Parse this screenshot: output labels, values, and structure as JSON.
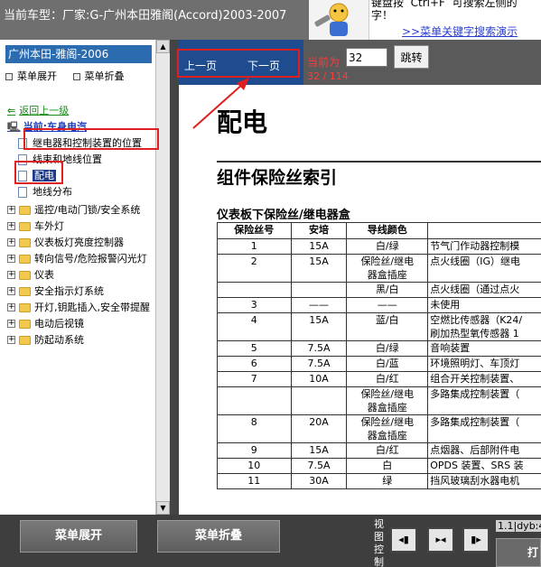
{
  "header": {
    "vehicle_title": "当前车型：厂家:G-广州本田雅阁(Accord)2003-2007",
    "hint_text": "键盘按  Ctrl+F  可搜索左侧的\n字！",
    "hint_link": ">>菜单关键字搜索演示"
  },
  "sidebar": {
    "brand": "广州本田-雅阁-2006",
    "expand_label": "菜单展开",
    "collapse_label": "菜单折叠",
    "back_label": "返回上一级",
    "current_label": "当前:车身电汽",
    "docs": [
      {
        "label": "继电器和控制装置的位置",
        "selected": false
      },
      {
        "label": "线束和地线位置",
        "selected": false
      },
      {
        "label": "配电",
        "selected": true
      },
      {
        "label": "地线分布",
        "selected": false
      }
    ],
    "folders": [
      {
        "label": "遥控/电动门锁/安全系统"
      },
      {
        "label": "车外灯"
      },
      {
        "label": "仪表板灯亮度控制器"
      },
      {
        "label": "转向信号/危险报警闪光灯"
      },
      {
        "label": "仪表"
      },
      {
        "label": "安全指示灯系统"
      },
      {
        "label": "开灯,钥匙插入,安全带提醒"
      },
      {
        "label": "电动后视镜"
      },
      {
        "label": "防起动系统"
      }
    ]
  },
  "nav": {
    "prev_label": "上一页",
    "next_label": "下一页",
    "page_label": "当前为",
    "page_value": "32",
    "jump_label": "跳转",
    "page_count": "32 / 114"
  },
  "document": {
    "section_title": "配电",
    "heading": "组件保险丝索引",
    "subheading": "仪表板下保险丝/继电器盒",
    "columns": [
      "保险丝号",
      "安培",
      "导线颜色",
      ""
    ],
    "rows": [
      {
        "no": "1",
        "amp": "15A",
        "wire": [
          "白/绿"
        ],
        "desc": [
          "节气门作动器控制模"
        ]
      },
      {
        "no": "2",
        "amp": "15A",
        "wire": [
          "保险丝/继电",
          "器盒插座"
        ],
        "desc": [
          "点火线圈（IG）继电"
        ]
      },
      {
        "no": "",
        "amp": "",
        "wire": [
          "黑/白"
        ],
        "desc": [
          "点火线圈（通过点火"
        ]
      },
      {
        "no": "3",
        "amp": "——",
        "wire": [
          "——"
        ],
        "desc": [
          "未使用"
        ]
      },
      {
        "no": "4",
        "amp": "15A",
        "wire": [
          "蓝/白"
        ],
        "desc": [
          "空燃比传感器（K24/",
          "刷加热型氧传感器 1"
        ]
      },
      {
        "no": "5",
        "amp": "7.5A",
        "wire": [
          "白/绿"
        ],
        "desc": [
          "音响装置"
        ]
      },
      {
        "no": "6",
        "amp": "7.5A",
        "wire": [
          "白/蓝"
        ],
        "desc": [
          "环境照明灯、车顶灯"
        ]
      },
      {
        "no": "7",
        "amp": "10A",
        "wire": [
          "白/红"
        ],
        "desc": [
          "组合开关控制装置、"
        ]
      },
      {
        "no": "",
        "amp": "",
        "wire": [
          "保险丝/继电",
          "器盒插座"
        ],
        "desc": [
          "多路集成控制装置（"
        ]
      },
      {
        "no": "8",
        "amp": "20A",
        "wire": [
          "保险丝/继电",
          "器盒插座"
        ],
        "desc": [
          "多路集成控制装置（"
        ]
      },
      {
        "no": "9",
        "amp": "15A",
        "wire": [
          "白/红"
        ],
        "desc": [
          "点烟器、后部附件电"
        ]
      },
      {
        "no": "10",
        "amp": "7.5A",
        "wire": [
          "白"
        ],
        "desc": [
          "OPDS 装置、SRS 装"
        ]
      },
      {
        "no": "11",
        "amp": "30A",
        "wire": [
          "绿"
        ],
        "desc": [
          "挡风玻璃刮水器电机"
        ]
      }
    ]
  },
  "bottom": {
    "expand_button": "菜单展开",
    "collapse_button": "菜单折叠",
    "view_label": "视图控制",
    "view_prev": "◂▮",
    "view_split": "▸◂",
    "view_next": "▮▸",
    "version": "1.1|dyb:4",
    "print_button": "打"
  },
  "colors": {
    "accent_blue": "#1e4c8e",
    "annotation_red": "#e02020",
    "page_text_red": "#ff3b3b"
  }
}
